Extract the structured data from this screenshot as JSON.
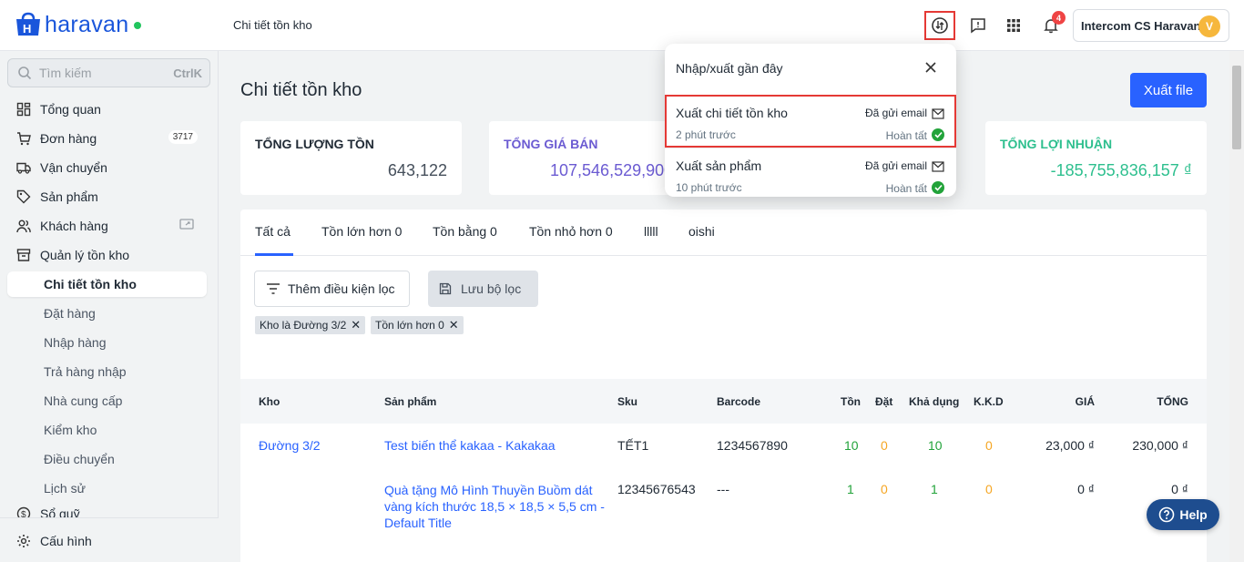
{
  "brand": {
    "name": "haravan"
  },
  "header": {
    "page_title": "Chi tiết tồn kho",
    "notification_count": "4",
    "user_name": "Intercom CS Haravan",
    "user_initial": "V"
  },
  "sidebar": {
    "search_placeholder": "Tìm kiếm",
    "search_shortcut": "CtrlK",
    "items": [
      {
        "label": "Tổng quan",
        "icon": "dashboard-icon"
      },
      {
        "label": "Đơn hàng",
        "icon": "cart-icon",
        "count": "3717"
      },
      {
        "label": "Vận chuyển",
        "icon": "truck-icon"
      },
      {
        "label": "Sản phẩm",
        "icon": "tag-icon"
      },
      {
        "label": "Khách hàng",
        "icon": "users-icon"
      },
      {
        "label": "Quản lý tồn kho",
        "icon": "inventory-icon"
      }
    ],
    "sub_items": [
      "Chi tiết tồn kho",
      "Đặt hàng",
      "Nhập hàng",
      "Trả hàng nhập",
      "Nhà cung cấp",
      "Kiểm kho",
      "Điều chuyển",
      "Lịch sử"
    ],
    "cashbook": "Sổ quỹ",
    "settings": "Cấu hình"
  },
  "main": {
    "title": "Chi tiết tồn kho",
    "export_button": "Xuất file",
    "cards": [
      {
        "label": "TỔNG LƯỢNG TỒN",
        "value": "643,122",
        "color": "#212b36"
      },
      {
        "label": "TỔNG GIÁ BÁN",
        "value": "107,546,529,900",
        "color": "#6b5bd2"
      },
      {
        "label": "TỔNG LỢI NHUẬN",
        "value": "-185,755,836,157 ₫",
        "color": "#2dbf8e"
      }
    ],
    "tabs": [
      "Tất cả",
      "Tồn lớn hơn 0",
      "Tồn bằng 0",
      "Tồn nhỏ hơn 0",
      "lllll",
      "oishi"
    ],
    "add_filter": "Thêm điều kiện lọc",
    "save_filter": "Lưu bộ lọc",
    "chips": [
      "Kho là Đường 3/2",
      "Tồn lớn hơn 0"
    ],
    "columns": [
      "Kho",
      "Sản phẩm",
      "Sku",
      "Barcode",
      "Tồn",
      "Đặt",
      "Khả dụng",
      "K.K.D",
      "GIÁ",
      "TỔNG"
    ],
    "rows": [
      {
        "kho": "Đường 3/2",
        "product": "Test biến thể kakaa - Kakakaa",
        "sku": "TẾT1",
        "barcode": "1234567890",
        "ton": "10",
        "dat": "0",
        "kha_dung": "10",
        "kkd": "0",
        "gia": "23,000 ₫",
        "tong": "230,000 ₫"
      },
      {
        "kho": "",
        "product": "Quà tặng Mô Hình Thuyền Buồm dát vàng kích thước 18,5 × 18,5 × 5,5 cm - Default Title",
        "sku": "12345676543",
        "barcode": "---",
        "ton": "1",
        "dat": "0",
        "kha_dung": "1",
        "kkd": "0",
        "gia": "0 ₫",
        "tong": "0 ₫"
      }
    ]
  },
  "popover": {
    "title": "Nhập/xuất gần đây",
    "items": [
      {
        "name": "Xuất chi tiết tồn kho",
        "time": "2 phút trước",
        "mail_status": "Đã gửi email",
        "status": "Hoàn tất"
      },
      {
        "name": "Xuất sản phẩm",
        "time": "10 phút trước",
        "mail_status": "Đã gửi email",
        "status": "Hoàn tất"
      }
    ]
  },
  "help_button": "Help"
}
